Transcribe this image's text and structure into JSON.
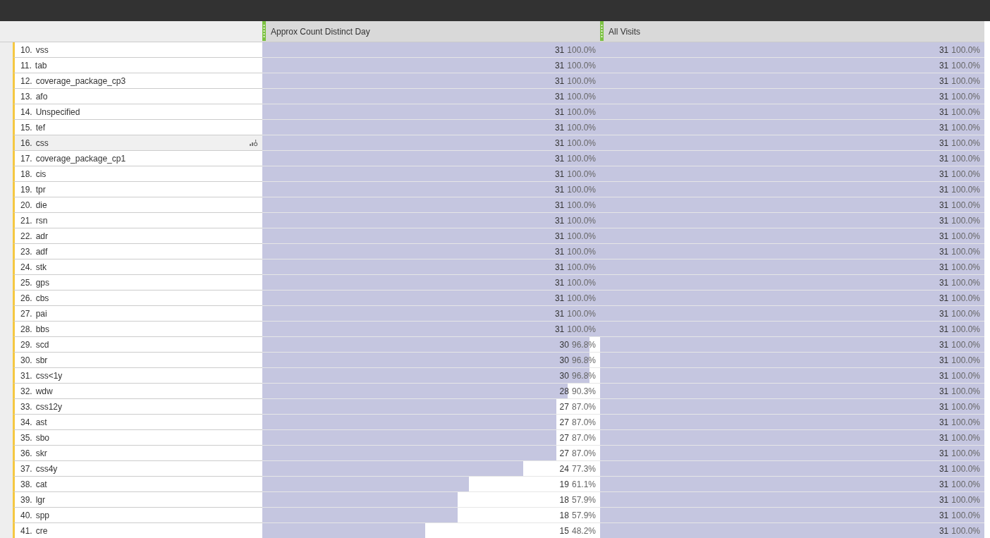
{
  "table": {
    "columns": [
      {
        "title": "Approx Count Distinct Day"
      },
      {
        "title": "All Visits"
      }
    ],
    "rows": [
      {
        "rank": "10.",
        "label": "vss",
        "hovered": false,
        "cells": [
          {
            "value": "31",
            "percent": "100.0%",
            "level": 1
          },
          {
            "value": "31",
            "percent": "100.0%",
            "level": 1
          }
        ]
      },
      {
        "rank": "11.",
        "label": "tab",
        "hovered": false,
        "cells": [
          {
            "value": "31",
            "percent": "100.0%",
            "level": 1
          },
          {
            "value": "31",
            "percent": "100.0%",
            "level": 1
          }
        ]
      },
      {
        "rank": "12.",
        "label": "coverage_package_cp3",
        "hovered": false,
        "cells": [
          {
            "value": "31",
            "percent": "100.0%",
            "level": 1
          },
          {
            "value": "31",
            "percent": "100.0%",
            "level": 1
          }
        ]
      },
      {
        "rank": "13.",
        "label": "afo",
        "hovered": false,
        "cells": [
          {
            "value": "31",
            "percent": "100.0%",
            "level": 1
          },
          {
            "value": "31",
            "percent": "100.0%",
            "level": 1
          }
        ]
      },
      {
        "rank": "14.",
        "label": "Unspecified",
        "hovered": false,
        "cells": [
          {
            "value": "31",
            "percent": "100.0%",
            "level": 1
          },
          {
            "value": "31",
            "percent": "100.0%",
            "level": 1
          }
        ]
      },
      {
        "rank": "15.",
        "label": "tef",
        "hovered": false,
        "cells": [
          {
            "value": "31",
            "percent": "100.0%",
            "level": 1
          },
          {
            "value": "31",
            "percent": "100.0%",
            "level": 1
          }
        ]
      },
      {
        "rank": "16.",
        "label": "css",
        "hovered": true,
        "cells": [
          {
            "value": "31",
            "percent": "100.0%",
            "level": 1
          },
          {
            "value": "31",
            "percent": "100.0%",
            "level": 1
          }
        ]
      },
      {
        "rank": "17.",
        "label": "coverage_package_cp1",
        "hovered": false,
        "cells": [
          {
            "value": "31",
            "percent": "100.0%",
            "level": 1
          },
          {
            "value": "31",
            "percent": "100.0%",
            "level": 1
          }
        ]
      },
      {
        "rank": "18.",
        "label": "cis",
        "hovered": false,
        "cells": [
          {
            "value": "31",
            "percent": "100.0%",
            "level": 1
          },
          {
            "value": "31",
            "percent": "100.0%",
            "level": 1
          }
        ]
      },
      {
        "rank": "19.",
        "label": "tpr",
        "hovered": false,
        "cells": [
          {
            "value": "31",
            "percent": "100.0%",
            "level": 1
          },
          {
            "value": "31",
            "percent": "100.0%",
            "level": 1
          }
        ]
      },
      {
        "rank": "20.",
        "label": "die",
        "hovered": false,
        "cells": [
          {
            "value": "31",
            "percent": "100.0%",
            "level": 1
          },
          {
            "value": "31",
            "percent": "100.0%",
            "level": 1
          }
        ]
      },
      {
        "rank": "21.",
        "label": "rsn",
        "hovered": false,
        "cells": [
          {
            "value": "31",
            "percent": "100.0%",
            "level": 1
          },
          {
            "value": "31",
            "percent": "100.0%",
            "level": 1
          }
        ]
      },
      {
        "rank": "22.",
        "label": "adr",
        "hovered": false,
        "cells": [
          {
            "value": "31",
            "percent": "100.0%",
            "level": 1
          },
          {
            "value": "31",
            "percent": "100.0%",
            "level": 1
          }
        ]
      },
      {
        "rank": "23.",
        "label": "adf",
        "hovered": false,
        "cells": [
          {
            "value": "31",
            "percent": "100.0%",
            "level": 1
          },
          {
            "value": "31",
            "percent": "100.0%",
            "level": 1
          }
        ]
      },
      {
        "rank": "24.",
        "label": "stk",
        "hovered": false,
        "cells": [
          {
            "value": "31",
            "percent": "100.0%",
            "level": 1
          },
          {
            "value": "31",
            "percent": "100.0%",
            "level": 1
          }
        ]
      },
      {
        "rank": "25.",
        "label": "gps",
        "hovered": false,
        "cells": [
          {
            "value": "31",
            "percent": "100.0%",
            "level": 1
          },
          {
            "value": "31",
            "percent": "100.0%",
            "level": 1
          }
        ]
      },
      {
        "rank": "26.",
        "label": "cbs",
        "hovered": false,
        "cells": [
          {
            "value": "31",
            "percent": "100.0%",
            "level": 1
          },
          {
            "value": "31",
            "percent": "100.0%",
            "level": 1
          }
        ]
      },
      {
        "rank": "27.",
        "label": "pai",
        "hovered": false,
        "cells": [
          {
            "value": "31",
            "percent": "100.0%",
            "level": 1
          },
          {
            "value": "31",
            "percent": "100.0%",
            "level": 1
          }
        ]
      },
      {
        "rank": "28.",
        "label": "bbs",
        "hovered": false,
        "cells": [
          {
            "value": "31",
            "percent": "100.0%",
            "level": 1
          },
          {
            "value": "31",
            "percent": "100.0%",
            "level": 1
          }
        ]
      },
      {
        "rank": "29.",
        "label": "scd",
        "hovered": false,
        "cells": [
          {
            "value": "30",
            "percent": "96.8%",
            "level": 0.968
          },
          {
            "value": "31",
            "percent": "100.0%",
            "level": 1
          }
        ]
      },
      {
        "rank": "30.",
        "label": "sbr",
        "hovered": false,
        "cells": [
          {
            "value": "30",
            "percent": "96.8%",
            "level": 0.968
          },
          {
            "value": "31",
            "percent": "100.0%",
            "level": 1
          }
        ]
      },
      {
        "rank": "31.",
        "label": "css<1y",
        "hovered": false,
        "cells": [
          {
            "value": "30",
            "percent": "96.8%",
            "level": 0.968
          },
          {
            "value": "31",
            "percent": "100.0%",
            "level": 1
          }
        ]
      },
      {
        "rank": "32.",
        "label": "wdw",
        "hovered": false,
        "cells": [
          {
            "value": "28",
            "percent": "90.3%",
            "level": 0.903
          },
          {
            "value": "31",
            "percent": "100.0%",
            "level": 1
          }
        ]
      },
      {
        "rank": "33.",
        "label": "css12y",
        "hovered": false,
        "cells": [
          {
            "value": "27",
            "percent": "87.0%",
            "level": 0.87
          },
          {
            "value": "31",
            "percent": "100.0%",
            "level": 1
          }
        ]
      },
      {
        "rank": "34.",
        "label": "ast",
        "hovered": false,
        "cells": [
          {
            "value": "27",
            "percent": "87.0%",
            "level": 0.87
          },
          {
            "value": "31",
            "percent": "100.0%",
            "level": 1
          }
        ]
      },
      {
        "rank": "35.",
        "label": "sbo",
        "hovered": false,
        "cells": [
          {
            "value": "27",
            "percent": "87.0%",
            "level": 0.87
          },
          {
            "value": "31",
            "percent": "100.0%",
            "level": 1
          }
        ]
      },
      {
        "rank": "36.",
        "label": "skr",
        "hovered": false,
        "cells": [
          {
            "value": "27",
            "percent": "87.0%",
            "level": 0.87
          },
          {
            "value": "31",
            "percent": "100.0%",
            "level": 1
          }
        ]
      },
      {
        "rank": "37.",
        "label": "css4y",
        "hovered": false,
        "cells": [
          {
            "value": "24",
            "percent": "77.3%",
            "level": 0.773
          },
          {
            "value": "31",
            "percent": "100.0%",
            "level": 1
          }
        ]
      },
      {
        "rank": "38.",
        "label": "cat",
        "hovered": false,
        "cells": [
          {
            "value": "19",
            "percent": "61.1%",
            "level": 0.611
          },
          {
            "value": "31",
            "percent": "100.0%",
            "level": 1
          }
        ]
      },
      {
        "rank": "39.",
        "label": "lgr",
        "hovered": false,
        "cells": [
          {
            "value": "18",
            "percent": "57.9%",
            "level": 0.579
          },
          {
            "value": "31",
            "percent": "100.0%",
            "level": 1
          }
        ]
      },
      {
        "rank": "40.",
        "label": "spp",
        "hovered": false,
        "cells": [
          {
            "value": "18",
            "percent": "57.9%",
            "level": 0.579
          },
          {
            "value": "31",
            "percent": "100.0%",
            "level": 1
          }
        ]
      },
      {
        "rank": "41.",
        "label": "cre",
        "hovered": false,
        "cells": [
          {
            "value": "15",
            "percent": "48.2%",
            "level": 0.482
          },
          {
            "value": "31",
            "percent": "100.0%",
            "level": 1
          }
        ]
      }
    ]
  }
}
